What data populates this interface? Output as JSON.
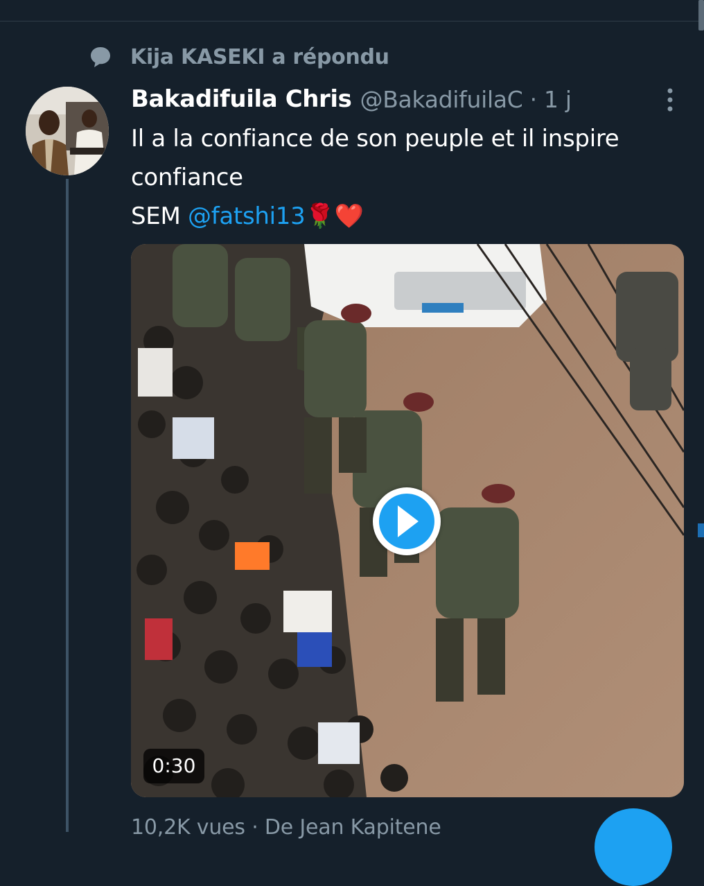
{
  "reply_context": {
    "icon": "speech-bubble-icon",
    "text": "Kija KASEKI a répondu"
  },
  "tweet": {
    "display_name": "Bakadifuila Chris",
    "handle": "@BakadifuilaC · 1 j",
    "text_line1": "Il a la confiance de son peuple et il inspire",
    "text_line2": "confiance",
    "text_line3_prefix": "SEM ",
    "mention": "@fatshi13",
    "emoji": "🌹❤️"
  },
  "media": {
    "duration": "0:30",
    "play_icon": "play-icon"
  },
  "footer": {
    "meta": "10,2K vues · De Jean Kapitene"
  },
  "colors": {
    "background": "#15202b",
    "accent": "#1da1f2",
    "secondary_text": "#8899a6"
  }
}
